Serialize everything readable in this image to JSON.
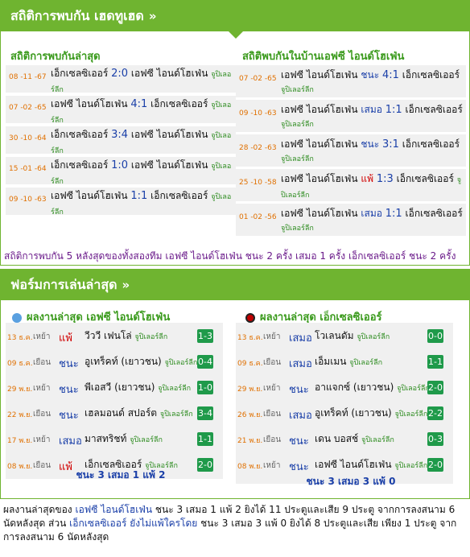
{
  "h2h": {
    "header": "สถิติการพบกัน เฮดทูเฮด",
    "arrow": "»",
    "left_title": "สถิติการพบกันล่าสุด",
    "right_title": "สถิติพบกันในบ้านเอฟซี ไอนด์โฮเฟ่น",
    "league": "จูปิเลอร์ลีก",
    "left_rows": [
      {
        "date": "08 -11 -67",
        "home": "เอ็กเซลซิเออร์",
        "score": "2:0",
        "away": "เอฟซี ไอนด์โฮเฟ่น"
      },
      {
        "date": "07 -02 -65",
        "home": "เอฟซี ไอนด์โฮเฟ่น",
        "score": "4:1",
        "away": "เอ็กเซลซิเออร์"
      },
      {
        "date": "30 -10 -64",
        "home": "เอ็กเซลซิเออร์",
        "score": "3:4",
        "away": "เอฟซี ไอนด์โฮเฟ่น"
      },
      {
        "date": "15 -01 -64",
        "home": "เอ็กเซลซิเออร์",
        "score": "1:0",
        "away": "เอฟซี ไอนด์โฮเฟ่น"
      },
      {
        "date": "09 -10 -63",
        "home": "เอฟซี ไอนด์โฮเฟ่น",
        "score": "1:1",
        "away": "เอ็กเซลซิเออร์"
      }
    ],
    "right_rows": [
      {
        "date": "07 -02 -65",
        "home": "เอฟซี ไอนด์โฮเฟ่น",
        "result": "ชนะ",
        "score": "4:1",
        "away": "เอ็กเซลซิเออร์",
        "kind": "win"
      },
      {
        "date": "09 -10 -63",
        "home": "เอฟซี ไอนด์โฮเฟ่น",
        "result": "เสมอ",
        "score": "1:1",
        "away": "เอ็กเซลซิเออร์",
        "kind": "draw"
      },
      {
        "date": "28 -02 -63",
        "home": "เอฟซี ไอนด์โฮเฟ่น",
        "result": "ชนะ",
        "score": "3:1",
        "away": "เอ็กเซลซิเออร์",
        "kind": "win"
      },
      {
        "date": "25 -10 -58",
        "home": "เอฟซี ไอนด์โฮเฟ่น",
        "result": "แพ้",
        "score": "1:3",
        "away": "เอ็กเซลซิเออร์",
        "kind": "loss"
      },
      {
        "date": "01 -02 -56",
        "home": "เอฟซี ไอนด์โฮเฟ่น",
        "result": "เสมอ",
        "score": "1:1",
        "away": "เอ็กเซลซิเออร์",
        "kind": "draw"
      }
    ],
    "summary": "สถิติการพบกัน 5 หลังสุดของทั้งสองทีม เอฟซี ไอนด์โฮเฟ่น ชนะ 2 ครั้ง เสมอ 1 ครั้ง เอ็กเซลซิเออร์ ชนะ 2 ครั้ง"
  },
  "form": {
    "header": "ฟอร์มการเล่นล่าสุด",
    "arrow": "»",
    "left_title": "ผลงานล่าสุด เอฟซี ไอนด์โฮเฟ่น",
    "right_title": "ผลงานล่าสุด เอ็กเซลซิเออร์",
    "left_rows": [
      {
        "date": "13 ธ.ค.",
        "ha": "เหย้า",
        "res": "แพ้",
        "kind": "loss",
        "opp": "วีววี เฟนโล่",
        "league": "จูปิเลอร์ลีก",
        "score": "1-3"
      },
      {
        "date": "09 ธ.ค.",
        "ha": "เยือน",
        "res": "ชนะ",
        "kind": "win",
        "opp": "อูเทร็คท์ (เยาวชน)",
        "league": "จูปิเลอร์ลีก",
        "score": "0-4"
      },
      {
        "date": "29 พ.ย.",
        "ha": "เหย้า",
        "res": "ชนะ",
        "kind": "win",
        "opp": "พีเอสวี (เยาวชน)",
        "league": "จูปิเลอร์ลีก",
        "score": "1-0"
      },
      {
        "date": "22 พ.ย.",
        "ha": "เยือน",
        "res": "ชนะ",
        "kind": "win",
        "opp": "เฮลมอนด์ สปอร์ต",
        "league": "จูปิเลอร์ลีก",
        "score": "3-4"
      },
      {
        "date": "17 พ.ย.",
        "ha": "เหย้า",
        "res": "เสมอ",
        "kind": "draw",
        "opp": "มาสทริชท์",
        "league": "จูปิเลอร์ลีก",
        "score": "1-1"
      },
      {
        "date": "08 พ.ย.",
        "ha": "เยือน",
        "res": "แพ้",
        "kind": "loss",
        "opp": "เอ็กเซลซิเออร์",
        "league": "จูปิเลอร์ลีก",
        "score": "2-0"
      }
    ],
    "right_rows": [
      {
        "date": "13 ธ.ค.",
        "ha": "เหย้า",
        "res": "เสมอ",
        "kind": "draw",
        "opp": "โวเลนดัม",
        "league": "จูปิเลอร์ลีก",
        "score": "0-0"
      },
      {
        "date": "09 ธ.ค.",
        "ha": "เยือน",
        "res": "เสมอ",
        "kind": "draw",
        "opp": "เอ็มเมน",
        "league": "จูปิเลอร์ลีก",
        "score": "1-1"
      },
      {
        "date": "29 พ.ย.",
        "ha": "เหย้า",
        "res": "ชนะ",
        "kind": "win",
        "opp": "อาแจกซ์ (เยาวชน)",
        "league": "จูปิเลอร์ลีก",
        "score": "2-0"
      },
      {
        "date": "26 พ.ย.",
        "ha": "เยือน",
        "res": "เสมอ",
        "kind": "draw",
        "opp": "อูเทร็คท์ (เยาวชน)",
        "league": "จูปิเลอร์ลีก",
        "score": "2-2"
      },
      {
        "date": "21 พ.ย.",
        "ha": "เยือน",
        "res": "ชนะ",
        "kind": "win",
        "opp": "เดน บอสช์",
        "league": "จูปิเลอร์ลีก",
        "score": "0-3"
      },
      {
        "date": "08 พ.ย.",
        "ha": "เหย้า",
        "res": "ชนะ",
        "kind": "win",
        "opp": "เอฟซี ไอนด์โฮเฟ่น",
        "league": "จูปิเลอร์ลีก",
        "score": "2-0"
      }
    ],
    "left_totals": "ชนะ 3 เสมอ 1 แพ้ 2",
    "right_totals": "ชนะ 3 เสมอ 3 แพ้ 0"
  },
  "footer": {
    "p1": "ผลงานล่าสุดของ ",
    "team1": "เอฟซี ไอนด์โฮเฟ่น",
    "p2": " ชนะ 3 เสมอ 1 แพ้ 2 ยิงได้ 11 ประตูและเสีย 9 ประตู จากการลงสนาม 6 นัดหลังสุด ส่วน ",
    "team2": "เอ็กเซลซิเออร์ ยังไม่แพ้ใครโดย",
    "p3": " ชนะ 3 เสมอ 3 แพ้ 0 ยิงได้ 8 ประตูและเสีย เพียง 1 ประตู จากการลงสนาม 6 นัดหลังสุด"
  },
  "colors": {
    "accent": "#6fb430",
    "score_badge": "#1f9a4a",
    "loss": "#d00000",
    "win": "#1a3fa8"
  }
}
